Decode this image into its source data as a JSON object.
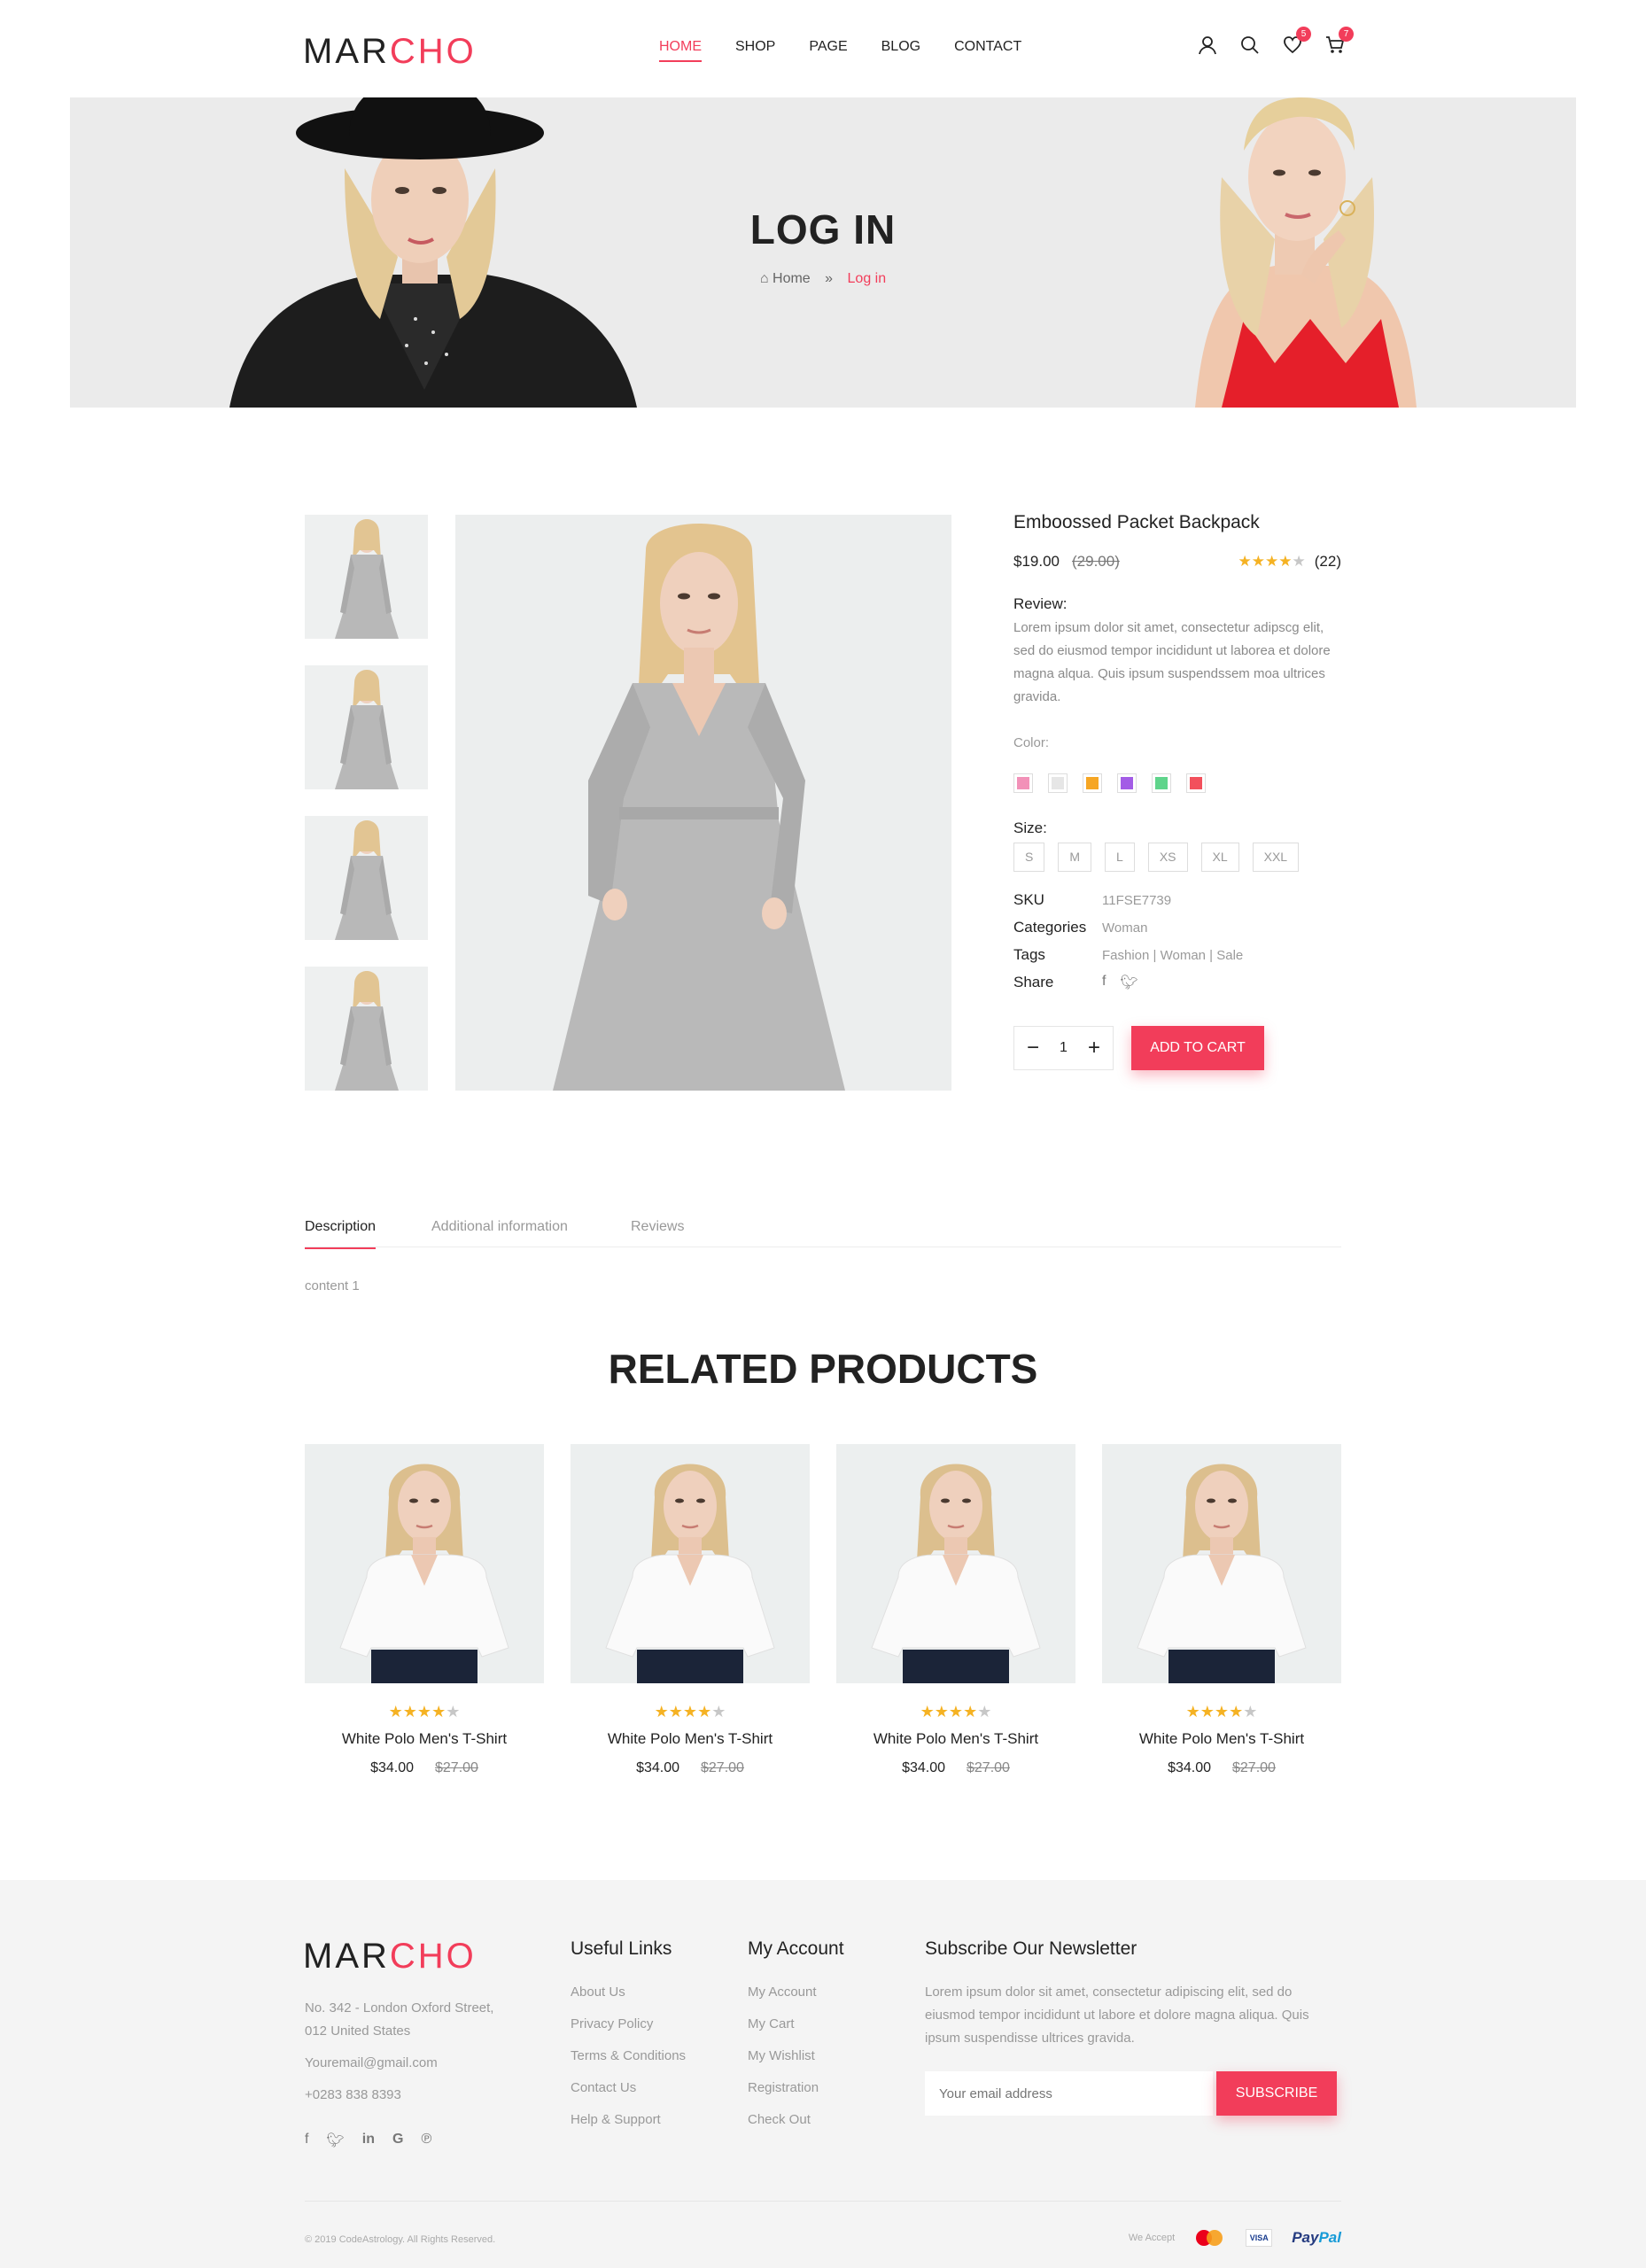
{
  "logo": {
    "part1": "MAR",
    "part2": "CHO"
  },
  "nav": [
    "HOME",
    "SHOP",
    "PAGE",
    "BLOG",
    "CONTACT"
  ],
  "header_icons": {
    "user": "user-icon",
    "search": "search-icon",
    "wishlist": "heart-icon",
    "cart": "cart-icon",
    "wishlist_count": "5",
    "cart_count": "7"
  },
  "hero": {
    "title": "LOG IN",
    "crumb_home": "Home",
    "crumb_current": "Log in"
  },
  "product": {
    "title": "Emboossed Packet Backpack",
    "price": "$19.00",
    "old_price": "(29.00)",
    "rating": 4,
    "review_count": "(22)",
    "review_label": "Review:",
    "description": "Lorem ipsum dolor sit amet, consectetur adipscg elit, sed do eiusmod tempor incididunt ut laborea et dolore magna alqua. Quis ipsum suspendssem moa ultrices gravida.",
    "color_label": "Color:",
    "colors": [
      "#f291b8",
      "#e6e6e6",
      "#f6a623",
      "#a35ce6",
      "#5fd48b",
      "#f2505c"
    ],
    "size_label": "Size:",
    "sizes": [
      "S",
      "M",
      "L",
      "XS",
      "XL",
      "XXL"
    ],
    "sku_label": "SKU",
    "sku": "11FSE7739",
    "categories_label": "Categories",
    "categories": "Woman",
    "tags_label": "Tags",
    "tags": "Fashion | Woman | Sale",
    "share_label": "Share",
    "quantity": "1",
    "add_to_cart": "ADD TO CART"
  },
  "tabs": [
    "Description",
    "Additional information",
    "Reviews"
  ],
  "tab_content": "content 1",
  "related": {
    "title": "RELATED PRODUCTS",
    "items": [
      {
        "name": "White Polo Men's T-Shirt",
        "price": "$34.00",
        "old_price": "$27.00"
      },
      {
        "name": "White Polo Men's T-Shirt",
        "price": "$34.00",
        "old_price": "$27.00"
      },
      {
        "name": "White Polo Men's T-Shirt",
        "price": "$34.00",
        "old_price": "$27.00"
      },
      {
        "name": "White Polo Men's T-Shirt",
        "price": "$34.00",
        "old_price": "$27.00"
      }
    ]
  },
  "footer": {
    "address_1": "No. 342 - London Oxford Street,",
    "address_2": "012 United States",
    "email": "Youremail@gmail.com",
    "phone": "+0283 838 8393",
    "useful_title": "Useful Links",
    "useful_links": [
      "About Us",
      "Privacy Policy",
      "Terms & Conditions",
      "Contact Us",
      "Help & Support"
    ],
    "account_title": "My Account",
    "account_links": [
      "My Account",
      "My Cart",
      "My Wishlist",
      "Registration",
      "Check Out"
    ],
    "newsletter_title": "Subscribe Our Newsletter",
    "newsletter_text": "Lorem ipsum dolor sit amet, consectetur adipiscing elit, sed do eiusmod tempor incididunt ut labore et dolore magna aliqua. Quis ipsum suspendisse ultrices gravida.",
    "email_placeholder": "Your email address",
    "subscribe": "SUBSCRIBE",
    "copyright": "© 2019 CodeAstrology. All Rights Reserved.",
    "we_accept": "We Accept",
    "visa": "VISA",
    "paypal_1": "Pay",
    "paypal_2": "Pal"
  }
}
